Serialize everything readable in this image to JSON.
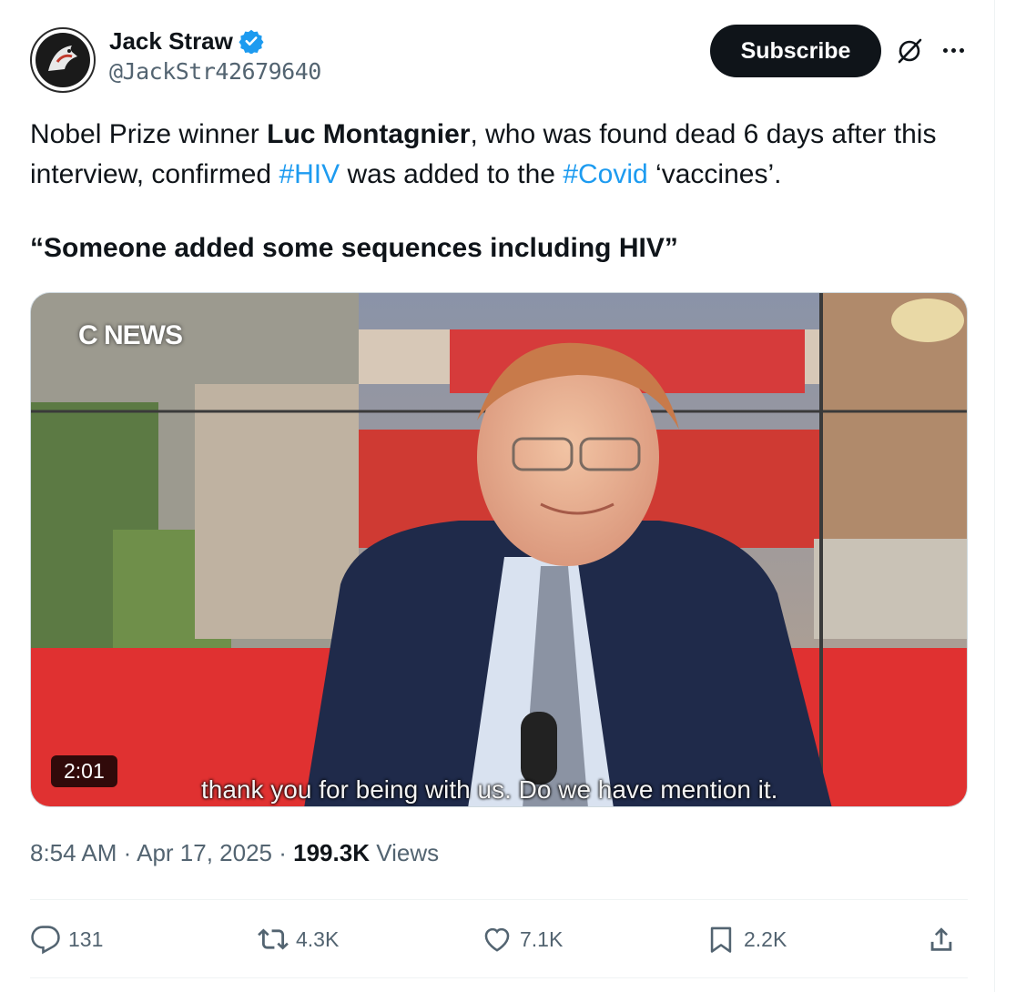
{
  "author": {
    "name": "Jack Straw",
    "handle": "@JackStr42679640",
    "verified": true,
    "avatar_icon": "avatar-logo-icon"
  },
  "header": {
    "subscribe_label": "Subscribe",
    "grok_icon": "grok-icon",
    "more_icon": "more-icon"
  },
  "post": {
    "text_prefix": "Nobel Prize winner ",
    "text_bold": "Luc Montagnier",
    "text_mid1": ", who was found dead 6 days after this interview, confirmed ",
    "tag1": "#HIV",
    "text_mid2": " was added to the ",
    "tag2": "#Covid",
    "text_end": " ‘vaccines’.",
    "quote": "“Someone added some sequences including HIV”"
  },
  "video": {
    "channel_logo": "C NEWS",
    "duration": "2:01",
    "subtitle": "thank you for being with us. Do we have mention it."
  },
  "meta": {
    "time": "8:54 AM",
    "sep1": "·",
    "date": "Apr 17, 2025",
    "sep2": "·",
    "views_count": "199.3K",
    "views_label": "Views"
  },
  "actions": {
    "replies": "131",
    "reposts": "4.3K",
    "likes": "7.1K",
    "bookmarks": "2.2K"
  },
  "colors": {
    "link": "#1d9bf0",
    "text": "#0f1419",
    "secondary": "#536471",
    "verified": "#1d9bf0"
  }
}
